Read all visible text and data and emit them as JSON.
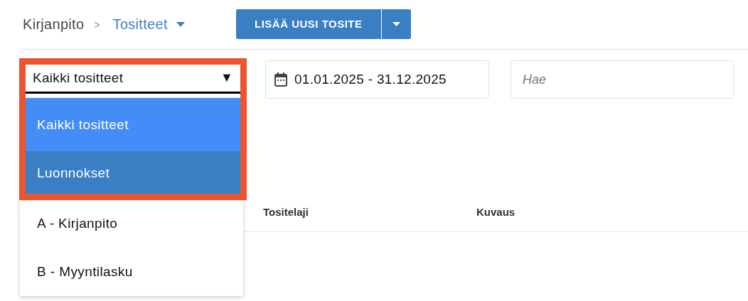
{
  "breadcrumb": {
    "parent": "Kirjanpito",
    "separator": ">",
    "current": "Tositteet"
  },
  "add_button": {
    "label": "LISÄÄ UUSI TOSITE"
  },
  "filter_select": {
    "value": "Kaikki tositteet",
    "arrow": "▼",
    "expanded": true,
    "options": [
      {
        "label": "Kaikki tositteet",
        "selected": true,
        "highlighted": false
      },
      {
        "label": "Luonnokset",
        "selected": false,
        "highlighted": true
      },
      {
        "label": "A - Kirjanpito",
        "selected": false,
        "highlighted": false
      },
      {
        "label": "B - Myyntilasku",
        "selected": false,
        "highlighted": false
      }
    ]
  },
  "highlight_frame": true,
  "date_range": {
    "value": "01.01.2025 - 31.12.2025"
  },
  "search": {
    "placeholder": "Hae"
  },
  "table": {
    "columns": [
      "Tositelaji",
      "Kuvaus"
    ]
  }
}
